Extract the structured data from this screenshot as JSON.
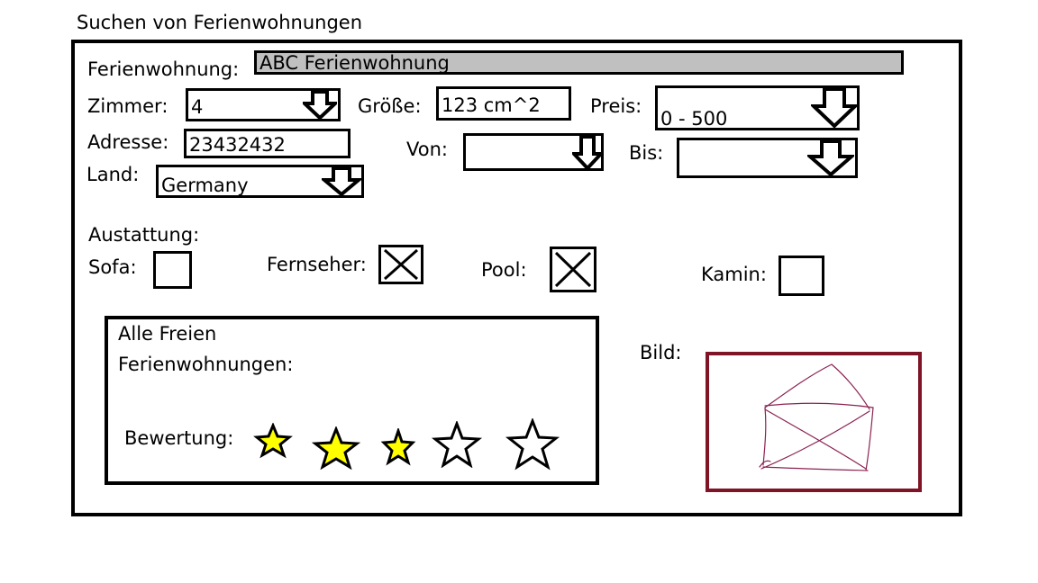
{
  "page_title": "Suchen von Ferienwohnungen",
  "fields": {
    "ferienwohnung_label": "Ferienwohnung:",
    "ferienwohnung_value": "ABC Ferienwohnung",
    "zimmer_label": "Zimmer:",
    "zimmer_value": "4",
    "groesse_label": "Größe:",
    "groesse_value": "123 cm^2",
    "preis_label": "Preis:",
    "preis_value": "0 - 500",
    "adresse_label": "Adresse:",
    "adresse_value": "23432432",
    "von_label": "Von:",
    "von_value": "",
    "bis_label": "Bis:",
    "bis_value": "",
    "land_label": "Land:",
    "land_value": "Germany"
  },
  "ausstattung": {
    "heading": "Austattung:",
    "items": [
      {
        "label": "Sofa:",
        "checked": false
      },
      {
        "label": "Fernseher:",
        "checked": true
      },
      {
        "label": "Pool:",
        "checked": true
      },
      {
        "label": "Kamin:",
        "checked": false
      }
    ]
  },
  "results": {
    "heading_line1": "Alle Freien",
    "heading_line2": "Ferienwohnungen:",
    "rating_label": "Bewertung:",
    "rating": 3,
    "max_rating": 5,
    "star_fill_color": "#ffff00"
  },
  "bild_label": "Bild:",
  "image_border_color": "#7f1426",
  "sketch_color": "#8b2252"
}
